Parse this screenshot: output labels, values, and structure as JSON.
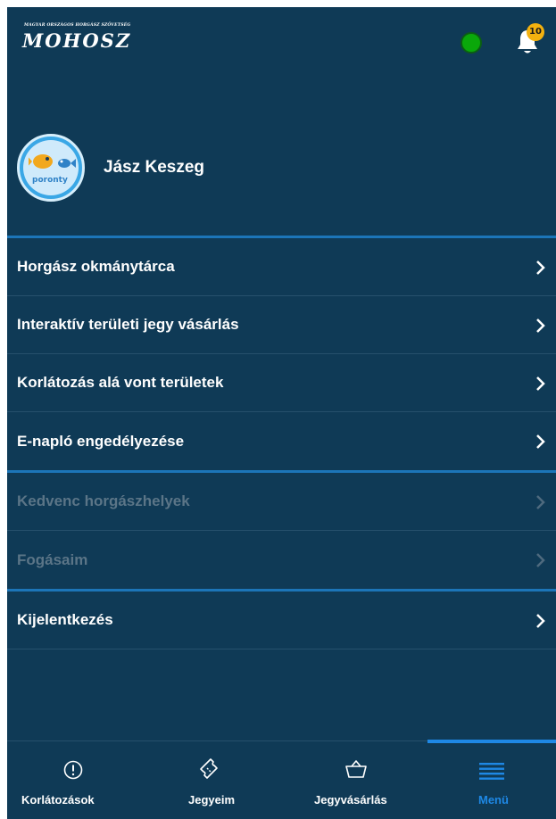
{
  "header": {
    "logo_small_text": "Magyar Országos Horgász Szövetség",
    "logo_text": "MOHOSZ",
    "status_color": "#0aa80a",
    "notification_count": "10"
  },
  "profile": {
    "name": "Jász Keszeg",
    "avatar_text": "poronty"
  },
  "menu": {
    "items": [
      {
        "label": "Horgász okmánytárca",
        "enabled": true
      },
      {
        "label": "Interaktív területi jegy vásárlás",
        "enabled": true
      },
      {
        "label": "Korlátozás alá vont területek",
        "enabled": true
      },
      {
        "label": "E-napló engedélyezése",
        "enabled": true
      },
      {
        "label": "Kedvenc horgászhelyek",
        "enabled": false
      },
      {
        "label": "Fogásaim",
        "enabled": false
      },
      {
        "label": "Kijelentkezés",
        "enabled": true
      }
    ]
  },
  "bottom_nav": {
    "items": [
      {
        "label": "Korlátozások",
        "icon": "alert-circle-icon"
      },
      {
        "label": "Jegyeim",
        "icon": "ticket-icon"
      },
      {
        "label": "Jegyvásárlás",
        "icon": "basket-icon"
      },
      {
        "label": "Menü",
        "icon": "menu-icon",
        "active": true
      }
    ]
  },
  "colors": {
    "background": "#0f3a56",
    "accent": "#1e88e5",
    "badge": "#f3b10f",
    "disabled_text": "#5b7587"
  }
}
